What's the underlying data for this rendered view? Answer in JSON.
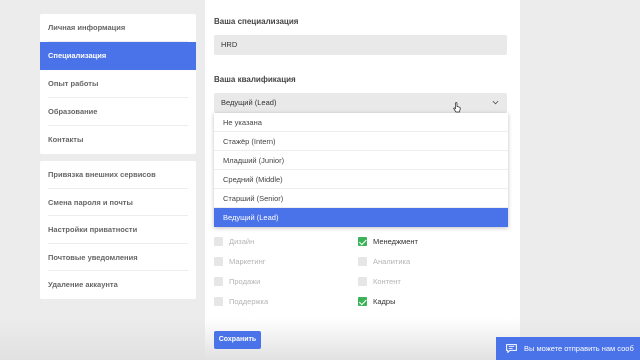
{
  "sidebar": {
    "profile_items": [
      {
        "label": "Личная информация",
        "active": false
      },
      {
        "label": "Специализация",
        "active": true
      },
      {
        "label": "Опыт работы",
        "active": false
      },
      {
        "label": "Образование",
        "active": false
      },
      {
        "label": "Контакты",
        "active": false
      }
    ],
    "account_items": [
      {
        "label": "Привязка внешних сервисов"
      },
      {
        "label": "Смена пароля и почты"
      },
      {
        "label": "Настройки приватности"
      },
      {
        "label": "Почтовые уведомления"
      },
      {
        "label": "Удаление аккаунта"
      }
    ]
  },
  "form": {
    "specialization_label": "Ваша специализация",
    "specialization_value": "HRD",
    "qualification_label": "Ваша квалификация",
    "qualification_value": "Ведущий (Lead)",
    "qualification_options": [
      "Не указана",
      "Стажёр (Intern)",
      "Младший (Junior)",
      "Средний (Middle)",
      "Старший (Senior)",
      "Ведущий (Lead)"
    ],
    "selected_option_index": 5,
    "skills_left": [
      {
        "label": "Дизайн",
        "checked": false
      },
      {
        "label": "Маркетинг",
        "checked": false
      },
      {
        "label": "Продажи",
        "checked": false
      },
      {
        "label": "Поддержка",
        "checked": false
      }
    ],
    "skills_right": [
      {
        "label": "Менеджмент",
        "checked": true
      },
      {
        "label": "Аналитика",
        "checked": false
      },
      {
        "label": "Контент",
        "checked": false
      },
      {
        "label": "Кадры",
        "checked": true
      }
    ],
    "save_label": "Сохранить"
  },
  "chat": {
    "text": "Вы можете отправить нам сооб"
  },
  "colors": {
    "accent": "#4b73e9",
    "check": "#3cb35a",
    "background": "#ececec"
  }
}
